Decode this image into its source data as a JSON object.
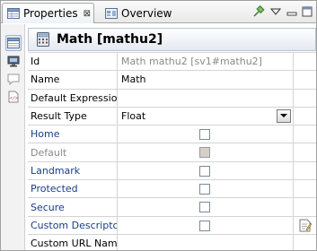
{
  "tabs": {
    "properties": {
      "label": "Properties",
      "close": "⊠"
    },
    "overview": {
      "label": "Overview"
    }
  },
  "toolbar": {
    "pin_icon": "pin-icon",
    "view_menu_icon": "view-menu-icon",
    "minimize_icon": "minimize-icon",
    "maximize_icon": "maximize-icon"
  },
  "sidebar": {
    "items": [
      {
        "icon": "properties-table-icon",
        "selected": true
      },
      {
        "icon": "monitor-icon",
        "selected": false
      },
      {
        "icon": "comment-icon",
        "selected": false
      },
      {
        "icon": "xml-document-icon",
        "selected": false
      }
    ]
  },
  "header": {
    "title": "Math [mathu2]",
    "icon": "calculator-icon"
  },
  "properties": {
    "id": {
      "label": "Id",
      "value": "Math mathu2  [sv1#mathu2]"
    },
    "name": {
      "label": "Name",
      "value": "Math"
    },
    "default_expression": {
      "label": "Default Expression",
      "value": ""
    },
    "result_type": {
      "label": "Result Type",
      "value": "Float"
    },
    "home": {
      "label": "Home",
      "checked": false
    },
    "default": {
      "label": "Default",
      "checked": false,
      "disabled": true
    },
    "landmark": {
      "label": "Landmark",
      "checked": false
    },
    "protected": {
      "label": "Protected",
      "checked": false
    },
    "secure": {
      "label": "Secure",
      "checked": false
    },
    "custom_descriptor": {
      "label": "Custom Descriptor",
      "checked": false,
      "action_icon": "edit-document-icon"
    },
    "custom_url_name": {
      "label": "Custom URL Name",
      "value": ""
    }
  },
  "colors": {
    "link_label": "#1a3c8c",
    "disabled_text": "#8a8a8a",
    "grid_line": "#d4d4d4",
    "title_bg": "#e4e9f1"
  }
}
